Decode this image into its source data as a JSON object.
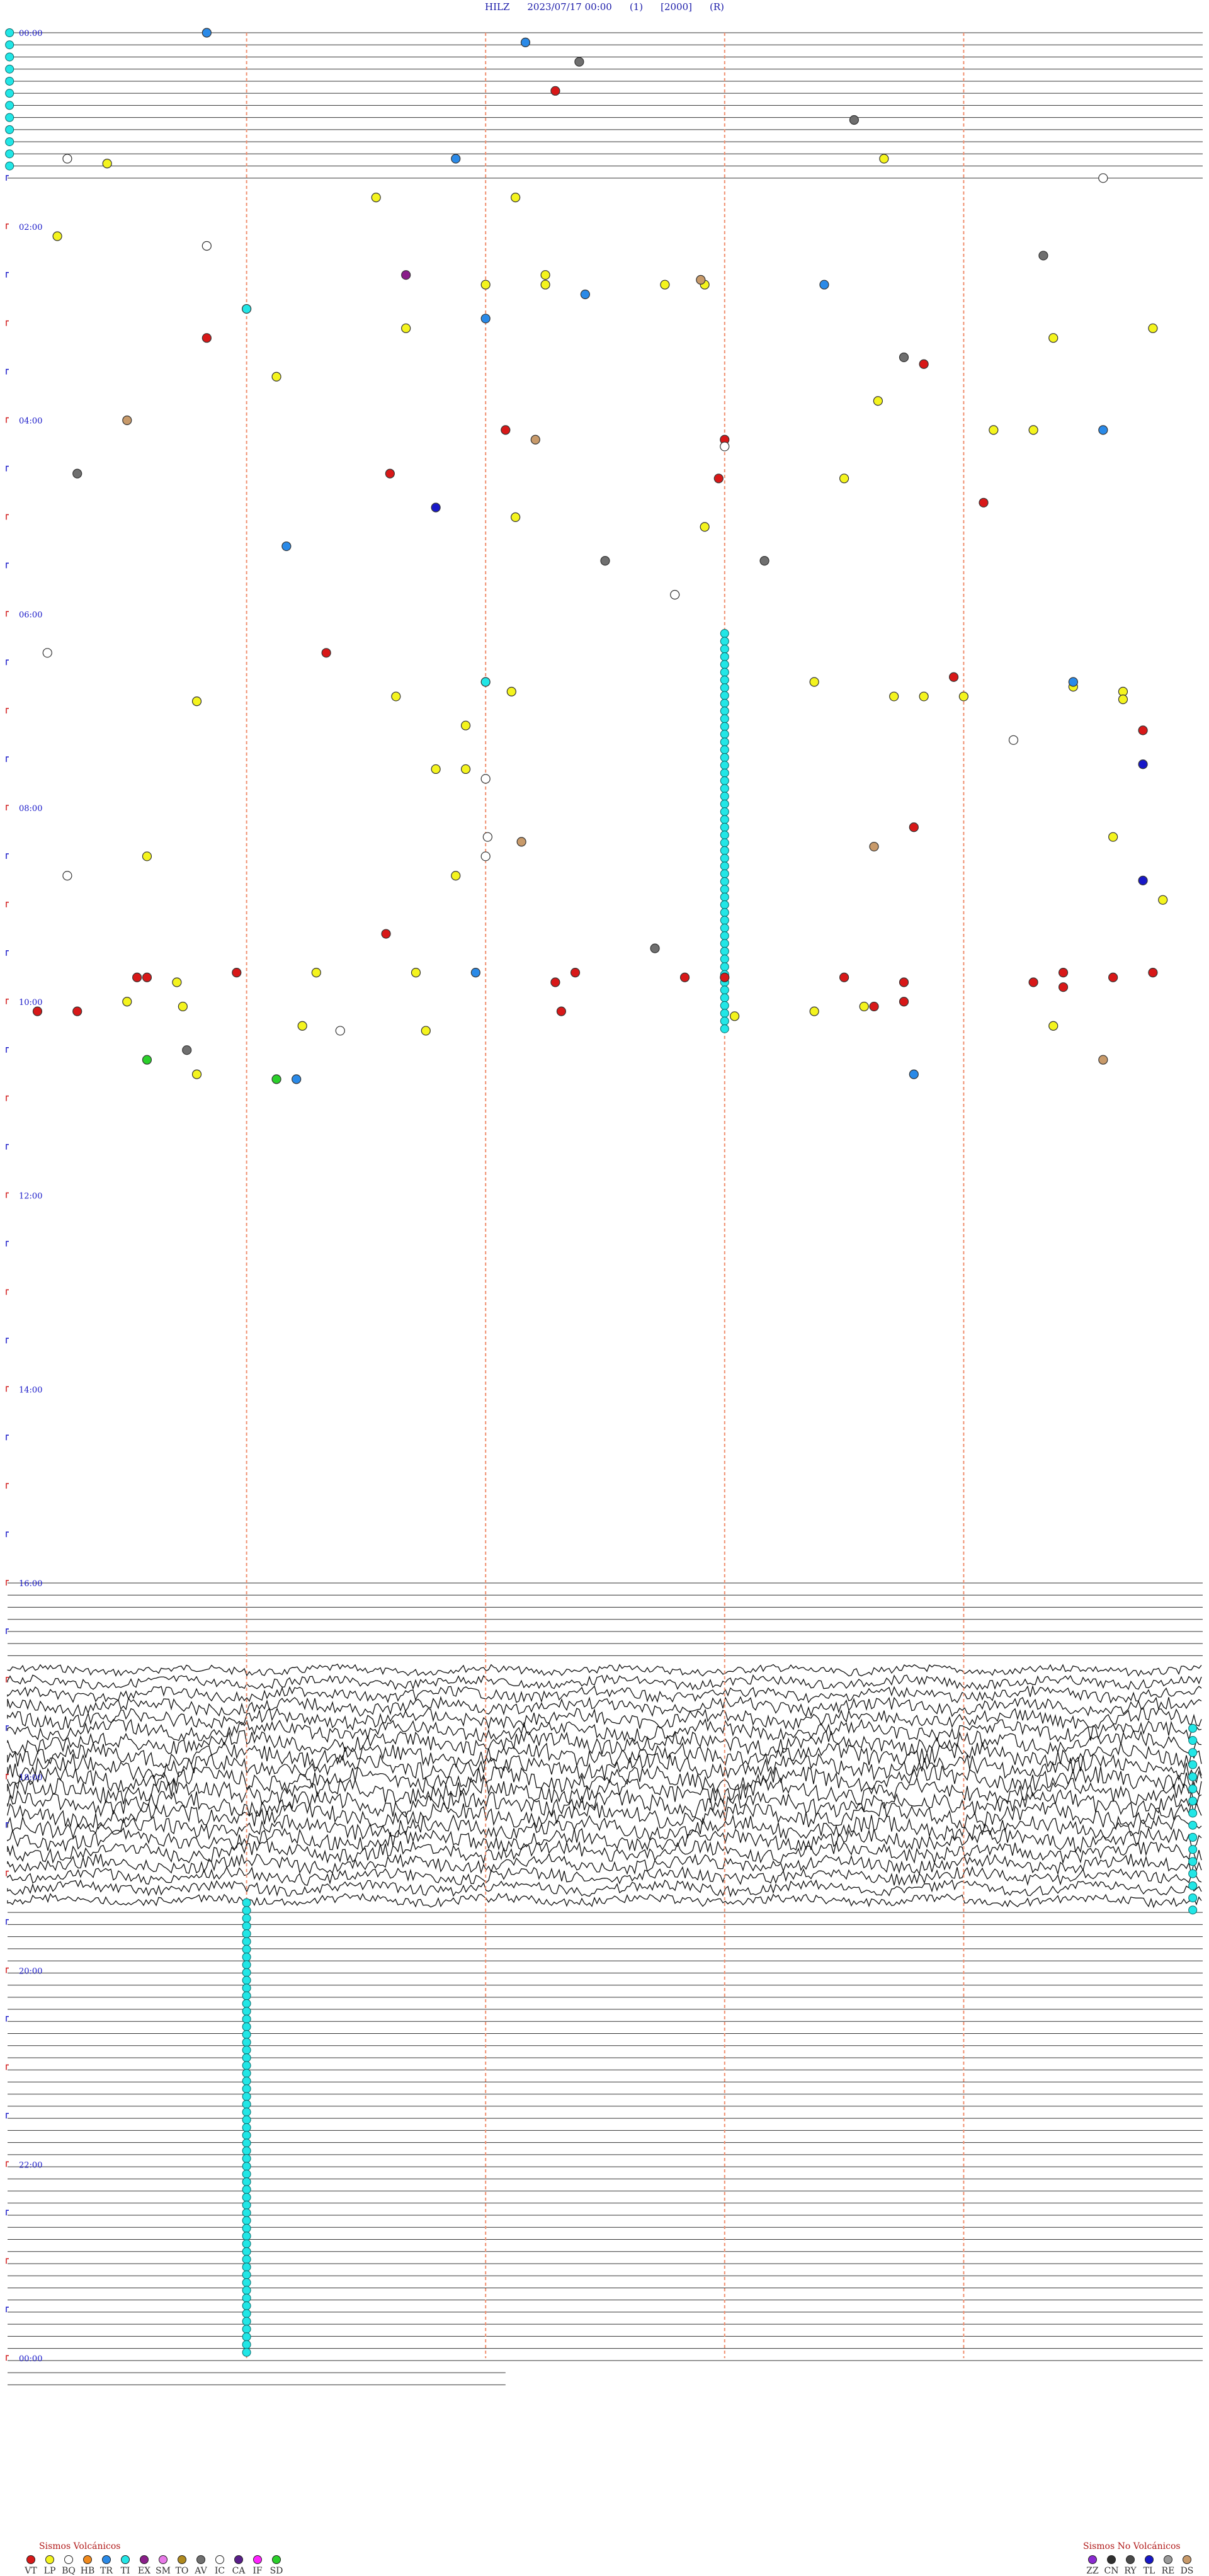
{
  "header": {
    "station": "HILZ",
    "datetime": "2023/07/17 00:00",
    "channel": "(1)",
    "scale": "[2000]",
    "mode": "(R)"
  },
  "colors": {
    "VT": "#d81818",
    "LP": "#f4f41e",
    "BQ": "#ffffff",
    "HB": "#f08a1e",
    "TR": "#2a8ae8",
    "TI": "#22e6e6",
    "EX": "#8a1e8a",
    "SM": "#e87ae8",
    "TO": "#b08a1e",
    "AV": "#6f6f6f",
    "IC": "#ffffff",
    "CA": "#5a1e8a",
    "IF": "#ff22ff",
    "SD": "#2ad02a",
    "ZZ": "#8a2ad0",
    "CN": "#303030",
    "RY": "#4a4a4a",
    "TL": "#1818c8",
    "RE": "#9a9a9a",
    "DS": "#c89a6a"
  },
  "chart_data": {
    "type": "scatter",
    "subtype": "helicorder",
    "x_unit": "minutes past hour",
    "xlim": [
      0,
      60
    ],
    "ylim": [
      "00:00",
      "24:00"
    ],
    "hour_labels": [
      "00:00",
      "02:00",
      "04:00",
      "06:00",
      "08:00",
      "10:00",
      "12:00",
      "14:00",
      "16:00",
      "18:00",
      "20:00",
      "22:00",
      "00:00"
    ],
    "gridline_minutes": [
      12,
      24,
      36,
      48
    ],
    "legend_volcanic": {
      "title": "Sismos Volcánicos",
      "items": [
        "VT",
        "LP",
        "BQ",
        "HB",
        "TR",
        "TI",
        "EX",
        "SM",
        "TO",
        "AV",
        "IC",
        "CA",
        "IF",
        "SD"
      ]
    },
    "legend_nonvolcanic": {
      "title": "Sismos No Volcánicos",
      "items": [
        "ZZ",
        "CN",
        "RY",
        "TL",
        "RE",
        "DS"
      ]
    },
    "events": [
      [
        "TR",
        0.0,
        10.0
      ],
      [
        "TR",
        0.1,
        26.0
      ],
      [
        "AV",
        0.3,
        28.7
      ],
      [
        "VT",
        0.6,
        27.5
      ],
      [
        "AV",
        0.9,
        42.5
      ],
      [
        "IC",
        1.3,
        3.0
      ],
      [
        "LP",
        1.35,
        5.0
      ],
      [
        "TR",
        1.3,
        22.5
      ],
      [
        "LP",
        1.3,
        44.0
      ],
      [
        "IC",
        1.5,
        55.0
      ],
      [
        "LP",
        1.7,
        18.5
      ],
      [
        "LP",
        1.7,
        25.5
      ],
      [
        "LP",
        2.1,
        2.5
      ],
      [
        "IC",
        2.2,
        10.0
      ],
      [
        "AV",
        2.3,
        52.0
      ],
      [
        "EX",
        2.5,
        20.0
      ],
      [
        "LP",
        2.5,
        27.0
      ],
      [
        "LP",
        2.6,
        24.0
      ],
      [
        "LP",
        2.6,
        27.0
      ],
      [
        "TR",
        2.7,
        29.0
      ],
      [
        "LP",
        2.6,
        33.0
      ],
      [
        "LP",
        2.6,
        35.0
      ],
      [
        "DS",
        2.55,
        34.8
      ],
      [
        "TR",
        2.6,
        41.0
      ],
      [
        "TI",
        2.85,
        12.0
      ],
      [
        "TR",
        2.95,
        24.0
      ],
      [
        "LP",
        3.05,
        20.0
      ],
      [
        "LP",
        3.05,
        57.5
      ],
      [
        "VT",
        3.15,
        10.0
      ],
      [
        "LP",
        3.15,
        52.5
      ],
      [
        "AV",
        3.35,
        45.0
      ],
      [
        "VT",
        3.42,
        46.0
      ],
      [
        "LP",
        3.55,
        13.5
      ],
      [
        "LP",
        3.8,
        43.7
      ],
      [
        "DS",
        4.0,
        6.0
      ],
      [
        "VT",
        4.1,
        25.0
      ],
      [
        "LP",
        4.1,
        49.5
      ],
      [
        "LP",
        4.1,
        51.5
      ],
      [
        "TR",
        4.1,
        55.0
      ],
      [
        "DS",
        4.2,
        26.5
      ],
      [
        "VT",
        4.2,
        36.0
      ],
      [
        "IC",
        4.27,
        36.0
      ],
      [
        "AV",
        4.55,
        3.5
      ],
      [
        "VT",
        4.55,
        19.2
      ],
      [
        "VT",
        4.6,
        35.7
      ],
      [
        "LP",
        4.6,
        42.0
      ],
      [
        "VT",
        4.85,
        49.0
      ],
      [
        "TL",
        4.9,
        21.5
      ],
      [
        "LP",
        5.0,
        25.5
      ],
      [
        "LP",
        5.1,
        35.0
      ],
      [
        "TR",
        5.3,
        14.0
      ],
      [
        "AV",
        5.45,
        30.0
      ],
      [
        "AV",
        5.45,
        38.0
      ],
      [
        "IC",
        5.8,
        33.5
      ],
      [
        "IC",
        6.4,
        2.0
      ],
      [
        "VT",
        6.4,
        16.0
      ],
      [
        "TI",
        6.7,
        24.0
      ],
      [
        "LP",
        6.7,
        40.5
      ],
      [
        "LP",
        6.75,
        53.5
      ],
      [
        "TR",
        6.7,
        53.5
      ],
      [
        "LP",
        6.8,
        25.3
      ],
      [
        "LP",
        6.9,
        9.5
      ],
      [
        "LP",
        6.85,
        19.5
      ],
      [
        "LP",
        6.85,
        44.5
      ],
      [
        "LP",
        6.85,
        48.0
      ],
      [
        "LP",
        6.85,
        46.0
      ],
      [
        "LP",
        6.8,
        56.0
      ],
      [
        "LP",
        6.88,
        56.0
      ],
      [
        "VT",
        6.65,
        47.5
      ],
      [
        "LP",
        8.5,
        7.0
      ],
      [
        "IC",
        8.5,
        24.0
      ],
      [
        "LP",
        7.15,
        23.0
      ],
      [
        "VT",
        7.2,
        57.0
      ],
      [
        "IC",
        7.3,
        50.5
      ],
      [
        "TL",
        7.55,
        57.0
      ],
      [
        "LP",
        7.6,
        21.5
      ],
      [
        "LP",
        7.6,
        23.0
      ],
      [
        "IC",
        7.7,
        24.0
      ],
      [
        "VT",
        8.2,
        45.5
      ],
      [
        "IC",
        8.3,
        24.1
      ],
      [
        "DS",
        8.35,
        25.8
      ],
      [
        "DS",
        8.4,
        43.5
      ],
      [
        "LP",
        8.3,
        55.5
      ],
      [
        "IC",
        8.7,
        3.0
      ],
      [
        "LP",
        8.7,
        22.5
      ],
      [
        "TL",
        8.75,
        57.0
      ],
      [
        "LP",
        8.95,
        58.0
      ],
      [
        "VT",
        9.3,
        19.0
      ],
      [
        "AV",
        9.45,
        32.5
      ],
      [
        "TR",
        9.7,
        23.5
      ],
      [
        "LP",
        9.7,
        20.5
      ],
      [
        "LP",
        9.7,
        15.5
      ],
      [
        "LP",
        9.8,
        8.5
      ],
      [
        "VT",
        9.7,
        11.5
      ],
      [
        "VT",
        9.75,
        6.5
      ],
      [
        "VT",
        9.75,
        7.0
      ],
      [
        "VT",
        9.75,
        34.0
      ],
      [
        "VT",
        9.7,
        28.5
      ],
      [
        "VT",
        9.8,
        27.5
      ],
      [
        "VT",
        9.75,
        36.0
      ],
      [
        "VT",
        9.75,
        42.0
      ],
      [
        "VT",
        9.8,
        45.0
      ],
      [
        "VT",
        9.8,
        51.5
      ],
      [
        "VT",
        9.85,
        53.0
      ],
      [
        "VT",
        9.7,
        53.0
      ],
      [
        "VT",
        9.75,
        55.5
      ],
      [
        "VT",
        9.7,
        57.5
      ],
      [
        "LP",
        10.0,
        6.0
      ],
      [
        "LP",
        10.05,
        8.8
      ],
      [
        "VT",
        10.1,
        1.5
      ],
      [
        "VT",
        10.1,
        3.5
      ],
      [
        "LP",
        10.1,
        40.5
      ],
      [
        "VT",
        10.05,
        43.5
      ],
      [
        "VT",
        10.0,
        45.0
      ],
      [
        "LP",
        10.05,
        43.0
      ],
      [
        "VT",
        10.1,
        27.8
      ],
      [
        "LP",
        10.15,
        36.5
      ],
      [
        "LP",
        10.25,
        14.8
      ],
      [
        "LP",
        10.25,
        52.5
      ],
      [
        "IC",
        10.3,
        16.7
      ],
      [
        "LP",
        10.3,
        21.0
      ],
      [
        "AV",
        10.5,
        9.0
      ],
      [
        "DS",
        10.6,
        55.0
      ],
      [
        "SD",
        10.6,
        7.0
      ],
      [
        "LP",
        10.75,
        9.5
      ],
      [
        "TR",
        10.75,
        45.5
      ],
      [
        "SD",
        10.8,
        13.5
      ],
      [
        "TR",
        10.8,
        14.5
      ]
    ]
  }
}
